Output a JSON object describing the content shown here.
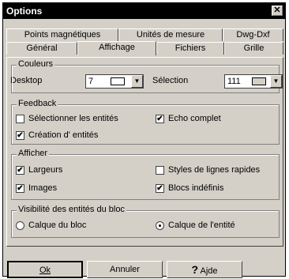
{
  "window": {
    "title": "Options",
    "close_glyph": "✕"
  },
  "tabs_back": [
    "Points magnétiques",
    "Unités de mesure",
    "Dwg-Dxf"
  ],
  "tabs_front": [
    "Général",
    "Affichage",
    "Fichiers",
    "Grille"
  ],
  "active_tab": "Affichage",
  "couleurs": {
    "legend": "Couleurs",
    "desktop_label": "Desktop",
    "desktop_value": "7",
    "selection_label": "Sélection",
    "selection_value": "111"
  },
  "feedback": {
    "legend": "Feedback",
    "select_entities": {
      "label": "Sélectionner les entités",
      "checked": false
    },
    "echo": {
      "label": "Echo complet",
      "checked": true
    },
    "create_entities": {
      "label": "Création d' entités",
      "checked": true
    }
  },
  "afficher": {
    "legend": "Afficher",
    "largeurs": {
      "label": "Largeurs",
      "checked": true
    },
    "styles": {
      "label": "Styles de lignes rapides",
      "checked": false
    },
    "images": {
      "label": "Images",
      "checked": true
    },
    "blocs": {
      "label": "Blocs indéfinis",
      "checked": true
    }
  },
  "visibilite": {
    "legend": "Visibilité des entités du bloc",
    "calque_bloc": {
      "label": "Calque du bloc",
      "selected": false
    },
    "calque_entite": {
      "label": "Calque de l'entité",
      "selected": true
    }
  },
  "buttons": {
    "ok": "Ok",
    "cancel": "Annuler",
    "help": "Ajde",
    "help_icon": "?"
  },
  "check_glyph": "✔"
}
